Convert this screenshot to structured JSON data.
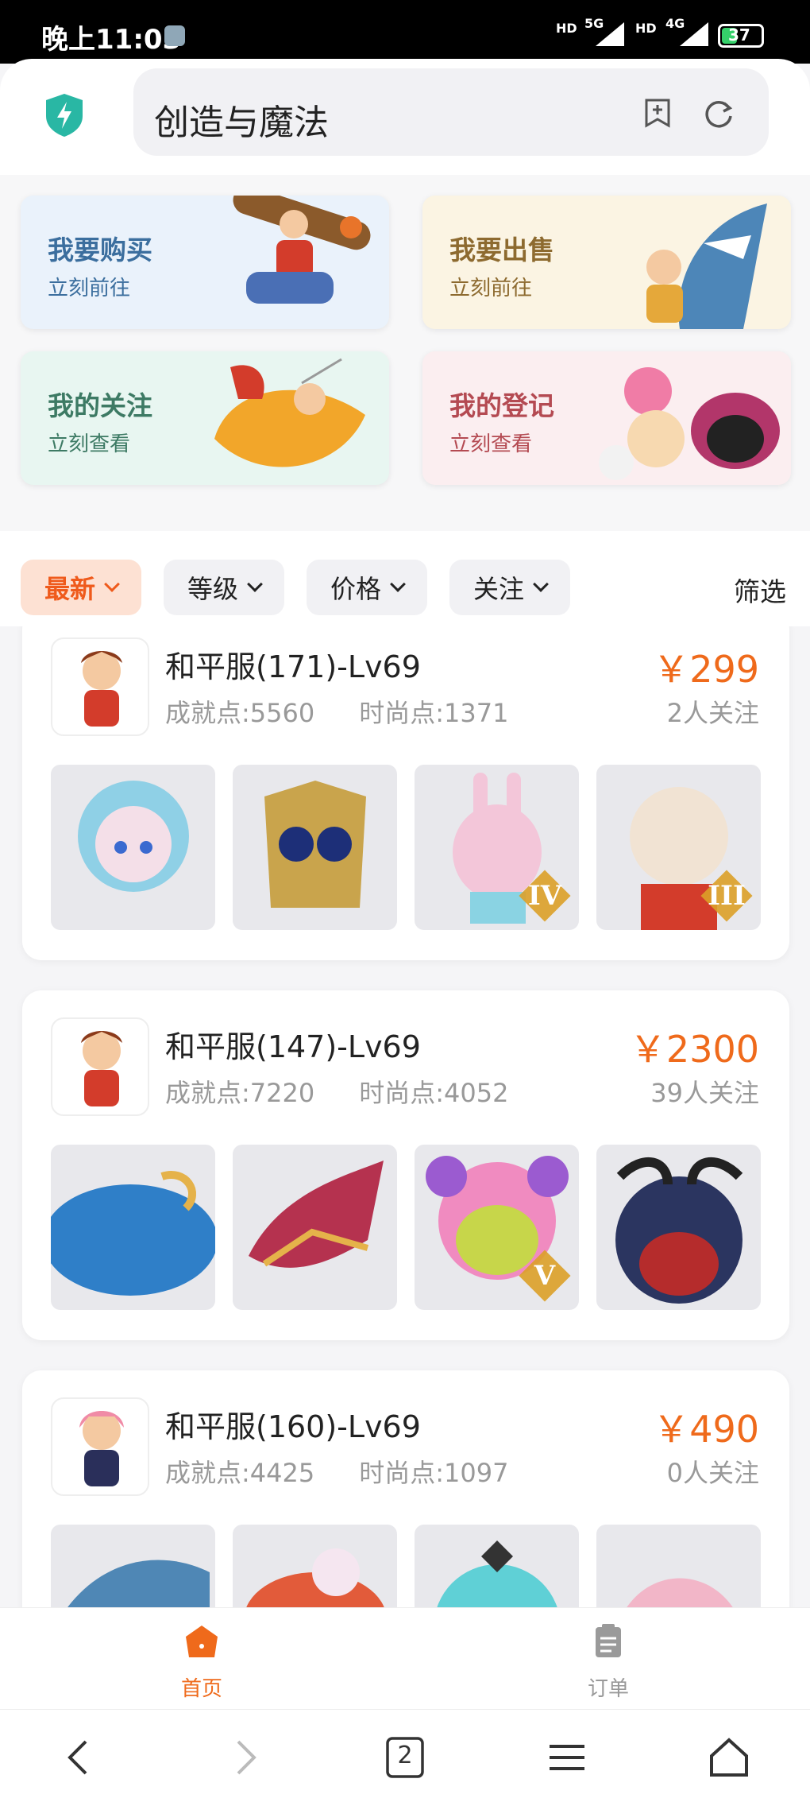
{
  "status": {
    "time": "晚上11:03",
    "net1": "5G",
    "net2": "4G",
    "battery": "37"
  },
  "header": {
    "query": "创造与魔法"
  },
  "quick": [
    {
      "title": "我要购买",
      "sub": "立刻前往",
      "color": "#3b6e9e",
      "bg": "#eaf2fb"
    },
    {
      "title": "我要出售",
      "sub": "立刻前往",
      "color": "#8d6a2f",
      "bg": "#fbf4e3"
    },
    {
      "title": "我的关注",
      "sub": "立刻查看",
      "color": "#3d7a64",
      "bg": "#e8f6f1"
    },
    {
      "title": "我的登记",
      "sub": "立刻查看",
      "color": "#b44a52",
      "bg": "#fbeef0"
    }
  ],
  "filters": {
    "newest": "最新",
    "level": "等级",
    "price": "价格",
    "follow": "关注",
    "screen": "筛选"
  },
  "listings": [
    {
      "title": "和平服(171)-Lv69",
      "achieve": "成就点:5560",
      "fashion": "时尚点:1371",
      "price": "￥299",
      "follows": "2人关注",
      "badges": [
        "",
        "",
        "IV",
        "III"
      ]
    },
    {
      "title": "和平服(147)-Lv69",
      "achieve": "成就点:7220",
      "fashion": "时尚点:4052",
      "price": "￥2300",
      "follows": "39人关注",
      "badges": [
        "",
        "",
        "V",
        ""
      ]
    },
    {
      "title": "和平服(160)-Lv69",
      "achieve": "成就点:4425",
      "fashion": "时尚点:1097",
      "price": "￥490",
      "follows": "0人关注",
      "badges": [
        "",
        "",
        "",
        ""
      ]
    }
  ],
  "tabs": {
    "home": "首页",
    "orders": "订单"
  },
  "nav": {
    "tabs_count": "2"
  },
  "colors": {
    "accent": "#ef6a1b",
    "home_icon": "#ef6a1b",
    "shield": "#29b7a4"
  }
}
